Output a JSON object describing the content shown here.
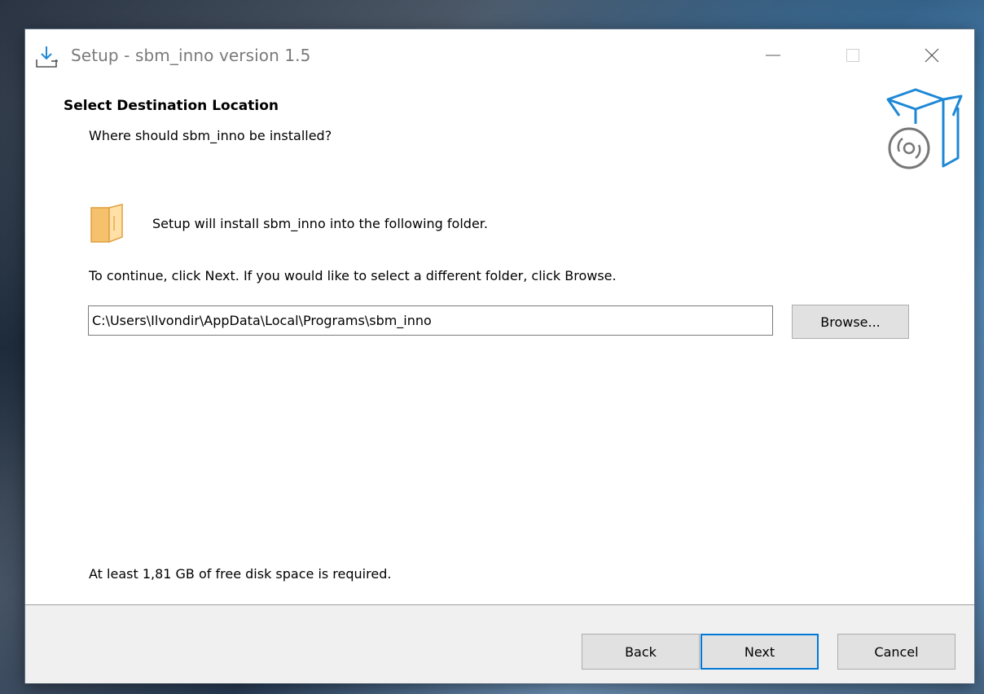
{
  "window": {
    "title": "Setup - sbm_inno version 1.5"
  },
  "header": {
    "title": "Select Destination Location",
    "subtitle": "Where should sbm_inno be installed?"
  },
  "content": {
    "install_text": "Setup will install sbm_inno into the following folder.",
    "instruction_text": "To continue, click Next. If you would like to select a different folder, click Browse.",
    "destination_path": "C:\\Users\\Ilvondir\\AppData\\Local\\Programs\\sbm_inno",
    "browse_label": "Browse...",
    "disk_space_text": "At least 1,81 GB of free disk space is required."
  },
  "footer": {
    "back_label": "Back",
    "next_label": "Next",
    "cancel_label": "Cancel"
  },
  "icons": {
    "app": "setup-download-icon",
    "logo": "software-box-disc-icon",
    "folder": "folder-icon",
    "minimize": "minimize-icon",
    "maximize": "maximize-icon",
    "close": "close-icon"
  },
  "colors": {
    "accent": "#0078d7",
    "folder": "#f5c16c",
    "logo": "#1e88d6"
  }
}
